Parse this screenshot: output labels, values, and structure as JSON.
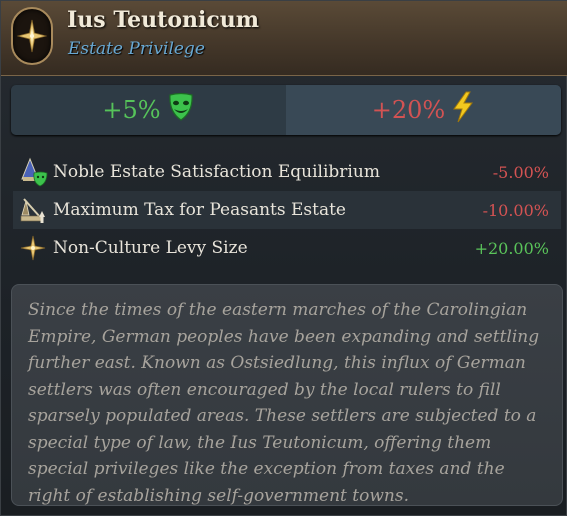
{
  "header": {
    "title": "Ius Teutonicum",
    "subtitle": "Estate Privilege",
    "emblem_icon": "compass-star-icon"
  },
  "summary": {
    "left_value": "+5%",
    "left_icon": "happy-mask-icon",
    "right_value": "+20%",
    "right_icon": "lightning-bolt-icon"
  },
  "modifiers": [
    {
      "icon": "noble-estate-satisfaction-icon",
      "label": "Noble Estate Satisfaction Equilibrium",
      "value": "-5.00%"
    },
    {
      "icon": "peasants-tax-icon",
      "label": "Maximum Tax for Peasants Estate",
      "value": "-10.00%"
    },
    {
      "icon": "levy-star-icon",
      "label": "Non-Culture Levy Size",
      "value": "+20.00%"
    }
  ],
  "description": "Since the times of the eastern marches of the Carolingian Empire, German peoples have been expanding and settling further east. Known as Ostsiedlung, this influx of German settlers was often encouraged by the local rulers to fill sparsely populated areas. These settlers are subjected to a special type of law, the Ius Teutonicum, offering them special privileges like the exception from taxes and the right of establishing self-government towns.",
  "colors": {
    "positive": "#5ac45a",
    "negative": "#d45353",
    "subtitle": "#69a8d2",
    "header_bg": "#45382a"
  }
}
